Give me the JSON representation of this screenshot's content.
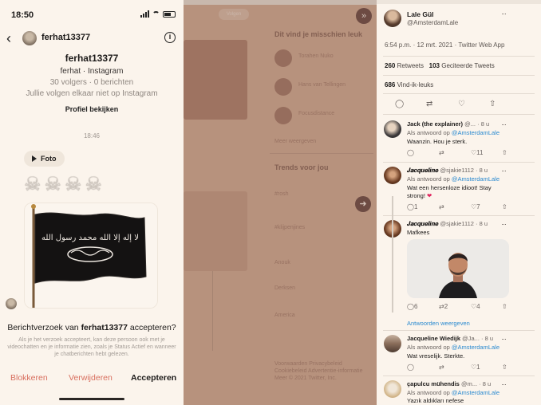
{
  "instagram": {
    "status_time": "18:50",
    "header_username": "ferhat13377",
    "profile": {
      "username": "ferhat13377",
      "subtitle": "ferhat · Instagram",
      "stats": "30 volgers · 0 berichten",
      "mutual": "Jullie volgen elkaar niet op Instagram",
      "view_profile": "Profiel bekijken"
    },
    "timestamp": "18:46",
    "photo_chip_label": "Foto",
    "skulls": [
      "☠",
      "☠",
      "☠",
      "☠"
    ],
    "flag_inscription": "لا إله إلا الله محمد رسول الله",
    "request": {
      "question_prefix": "Berichtverzoek van ",
      "question_user": "ferhat13377",
      "question_suffix": " accepteren?",
      "description": "Als je het verzoek accepteert, kan deze persoon ook met je videochatten en je informatie zien, zoals je Status Actief en wanneer je chatberichten hebt gelezen."
    },
    "actions": {
      "block": "Blokkeren",
      "delete": "Verwijderen",
      "accept": "Accepteren"
    }
  },
  "middle": {
    "follow_button": "Volgen",
    "who_to_follow_heading": "Dit vind je misschien leuk",
    "suggestions": [
      "Torahen Nuko",
      "Hans van Tellingen",
      "Focusdistance"
    ],
    "show_more": "Meer weergeven",
    "trends_heading": "Trends voor jou",
    "trends": [
      "#rosh",
      "#klijpenjines",
      "Anouk",
      "Derksen",
      "America"
    ],
    "footer": "Voorwaarden Privacybeleid Cookiebeleid Advertentie-informatie Meer © 2021 Twitter, Inc."
  },
  "twitter": {
    "author": {
      "name": "Lale Gül",
      "handle": "@AmsterdamLale"
    },
    "meta": "6:54 p.m. · 12 mrt. 2021 · Twitter Web App",
    "retweets": {
      "count": "260",
      "label": "Retweets"
    },
    "quotes": {
      "count": "103",
      "label": "Geciteerde Tweets"
    },
    "likes": {
      "count": "686",
      "label": "Vind-ik-leuks"
    },
    "replying_prefix": "Als antwoord op ",
    "replying_to": "@AmsterdamLale",
    "replies": [
      {
        "name": "Jack (the explainer)",
        "handle": "@...",
        "time": "8 u",
        "text": "Waanzin. Hou je sterk.",
        "retweets": "",
        "likes": "11"
      },
      {
        "name": "𝑱𝒂𝒄𝒒𝒖𝒆𝒍𝒊𝒏𝒆",
        "handle": "@sjakie1112",
        "time": "8 u",
        "text": "Wat een hersenloze idioot! Stay strong!",
        "replies": "1",
        "retweets": "",
        "likes": "7"
      },
      {
        "name": "𝑱𝒂𝒄𝒒𝒖𝒆𝒍𝒊𝒏𝒆",
        "handle": "@sjakie1112",
        "time": "8 u",
        "text": "Mafkees",
        "replies": "6",
        "retweets": "2",
        "likes": "4"
      },
      {
        "name": "Jacqueline Wiedijk",
        "handle": "@Ja...",
        "time": "8 u",
        "text": "Wat vreselijk.  Sterkte.",
        "retweets": "",
        "likes": "1"
      },
      {
        "name": "çapulcu mühendis",
        "handle": "@m...",
        "time": "8 u",
        "text": "Yazık aldıkları nefese"
      }
    ],
    "show_replies": "Antwoorden weergeven"
  }
}
